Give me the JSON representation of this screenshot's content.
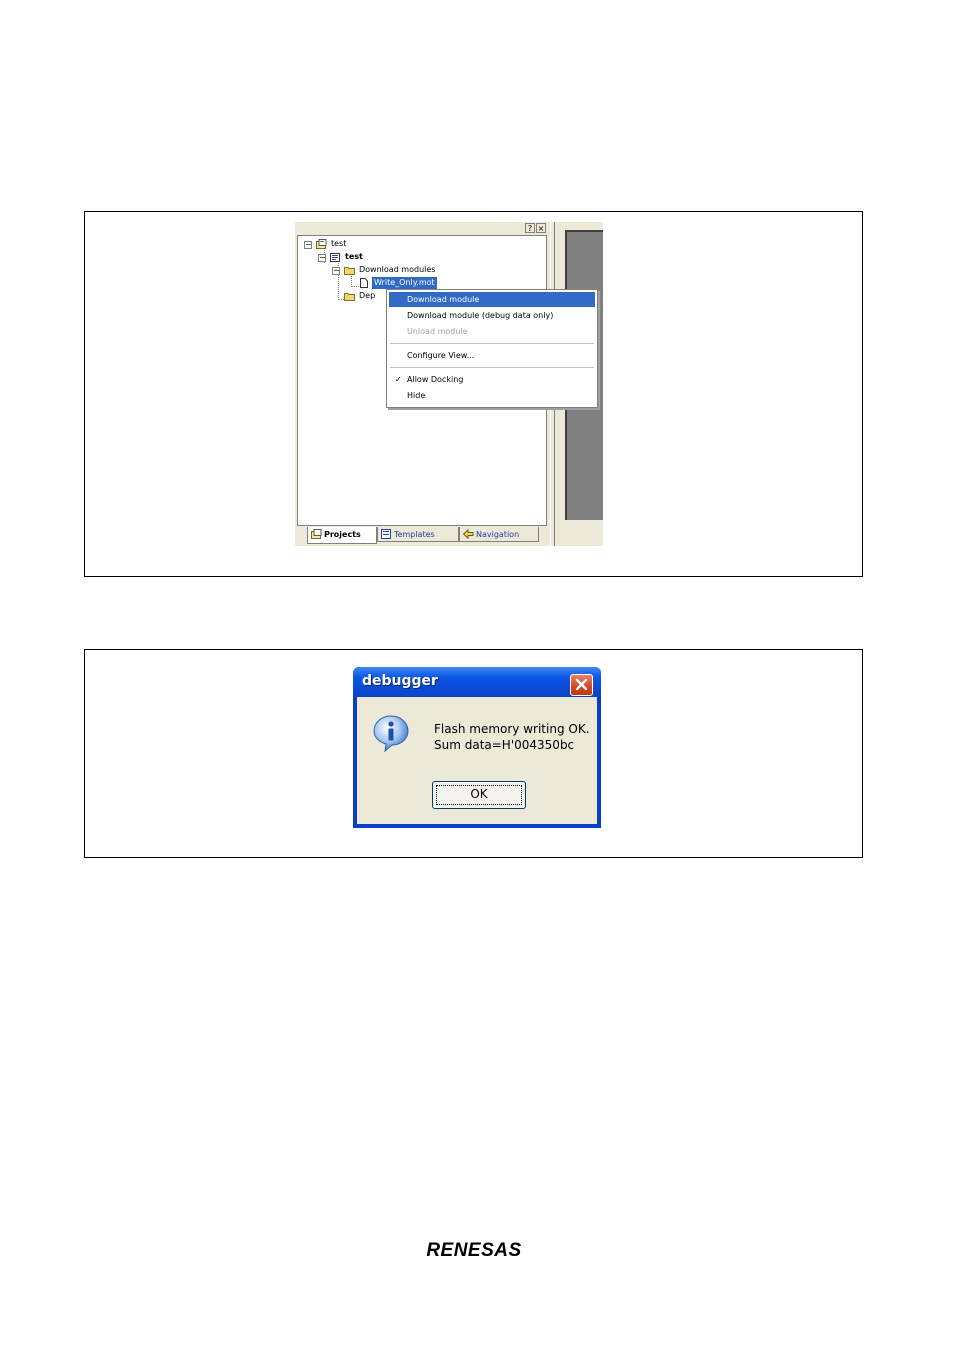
{
  "workspace": {
    "dock_pin": "?",
    "dock_close": "×",
    "tree": {
      "root": "test",
      "project": "test",
      "download_folder": "Download modules",
      "module_file": "Write_Only.mot",
      "dependency_folder": "Dep"
    },
    "tabs": [
      {
        "label": "Projects",
        "active": true
      },
      {
        "label": "Templates",
        "active": false
      },
      {
        "label": "Navigation",
        "active": false
      }
    ]
  },
  "context_menu": {
    "items": [
      {
        "label": "Download module",
        "highlighted": true,
        "enabled": true
      },
      {
        "label": "Download module (debug data only)",
        "enabled": true
      },
      {
        "label": "Unload module",
        "enabled": false
      },
      {
        "label": "Configure View...",
        "enabled": true
      },
      {
        "label": "Allow Docking",
        "checked": true,
        "enabled": true
      },
      {
        "label": "Hide",
        "enabled": true
      }
    ],
    "check_mark": "✓"
  },
  "dialog": {
    "title": "debugger",
    "message_line1": "Flash memory writing OK.",
    "message_line2": "Sum data=H'004350bc",
    "ok_label": "OK",
    "icon": "info-icon"
  },
  "footer": {
    "logo_text": "RENESAS"
  },
  "colors": {
    "selection": "#316ac5",
    "dialog_title": "#0b58e6",
    "dialog_face": "#ece9d8",
    "close_red": "#d2461f"
  }
}
